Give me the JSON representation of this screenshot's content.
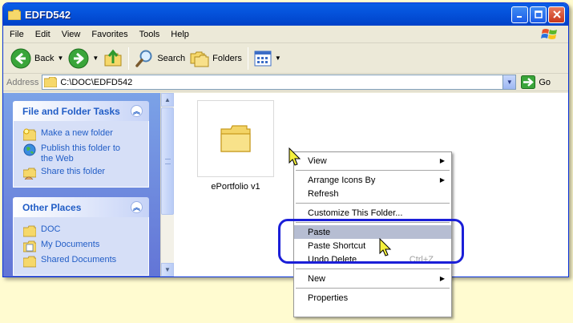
{
  "window": {
    "title": "EDFD542"
  },
  "menubar": {
    "items": [
      "File",
      "Edit",
      "View",
      "Favorites",
      "Tools",
      "Help"
    ]
  },
  "toolbar": {
    "back_label": "Back",
    "search_label": "Search",
    "folders_label": "Folders"
  },
  "addressbar": {
    "label": "Address",
    "path": "C:\\DOC\\EDFD542",
    "go_label": "Go"
  },
  "taskpane": {
    "file_tasks": {
      "title": "File and Folder Tasks",
      "items": [
        {
          "label": "Make a new folder",
          "icon": "new-folder-icon"
        },
        {
          "label": "Publish this folder to the Web",
          "icon": "globe-icon"
        },
        {
          "label": "Share this folder",
          "icon": "share-folder-icon"
        }
      ]
    },
    "other_places": {
      "title": "Other Places",
      "items": [
        {
          "label": "DOC",
          "icon": "folder-icon"
        },
        {
          "label": "My Documents",
          "icon": "documents-icon"
        },
        {
          "label": "Shared Documents",
          "icon": "folder-icon"
        }
      ]
    }
  },
  "files": [
    {
      "label": "ePortfolio v1",
      "icon": "folder-icon"
    }
  ],
  "context_menu": {
    "view": "View",
    "arrange": "Arrange Icons By",
    "refresh": "Refresh",
    "customize": "Customize This Folder...",
    "paste": "Paste",
    "paste_shortcut": "Paste Shortcut",
    "undo": "Undo Delete",
    "undo_shortcut": "Ctrl+Z",
    "new": "New",
    "properties": "Properties"
  },
  "colors": {
    "titlebar": "#0553dc",
    "callout": "#1b1fd8",
    "highlight": "#b6bdd2",
    "background": "#fffbd0"
  }
}
